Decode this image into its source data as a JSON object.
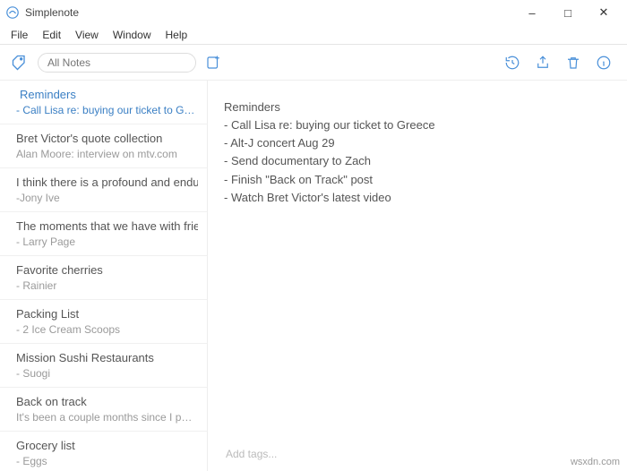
{
  "window": {
    "title": "Simplenote",
    "minimize": "–",
    "maximize": "□",
    "close": "✕"
  },
  "menu": {
    "file": "File",
    "edit": "Edit",
    "view": "View",
    "window": "Window",
    "help": "Help"
  },
  "toolbar": {
    "search_placeholder": "All Notes"
  },
  "notes": [
    {
      "title": "Reminders",
      "preview": "- Call Lisa re: buying our ticket to Greece",
      "selected": true,
      "pinned": true
    },
    {
      "title": "Bret Victor's quote collection",
      "preview": "Alan Moore: interview on mtv.com",
      "selected": false,
      "pinned": false
    },
    {
      "title": "I think there is a profound and enduring...",
      "preview": "-Jony Ive",
      "selected": false,
      "pinned": false
    },
    {
      "title": "The moments that we have with friends ...",
      "preview": "- Larry Page",
      "selected": false,
      "pinned": false
    },
    {
      "title": "Favorite cherries",
      "preview": "- Rainier",
      "selected": false,
      "pinned": false
    },
    {
      "title": "Packing List",
      "preview": "- 2 Ice Cream Scoops",
      "selected": false,
      "pinned": false
    },
    {
      "title": "Mission Sushi Restaurants",
      "preview": "- Suogi",
      "selected": false,
      "pinned": false
    },
    {
      "title": "Back on track",
      "preview": "It's been a couple months since I posted on m...",
      "selected": false,
      "pinned": false
    },
    {
      "title": "Grocery list",
      "preview": "- Eggs",
      "selected": false,
      "pinned": false
    }
  ],
  "editor": {
    "body": "Reminders\n- Call Lisa re: buying our ticket to Greece\n- Alt-J concert Aug 29\n- Send documentary to Zach\n- Finish \"Back on Track\" post\n- Watch Bret Victor's latest video",
    "tags_placeholder": "Add tags..."
  },
  "watermark": "wsxdn.com"
}
